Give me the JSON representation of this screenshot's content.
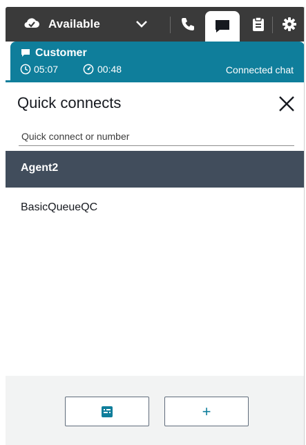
{
  "topbar": {
    "status_label": "Available",
    "icons": [
      "cloud-status-icon",
      "chevron-down-icon",
      "phone-icon",
      "chat-icon",
      "clipboard-icon",
      "gear-icon"
    ]
  },
  "contact": {
    "name": "Customer",
    "duration": "05:07",
    "state_time": "00:48",
    "state": "Connected chat"
  },
  "panel": {
    "title": "Quick connects",
    "search_placeholder": "Quick connect or number",
    "items": [
      {
        "label": "Agent2",
        "selected": true
      },
      {
        "label": "BasicQueueQC",
        "selected": false
      }
    ],
    "footer_buttons": [
      {
        "icon": "directory-icon"
      },
      {
        "icon": "plus-icon",
        "label": "+"
      }
    ]
  },
  "colors": {
    "topbar": "#3a3a3a",
    "accent": "#0f7e9b",
    "selected_row": "#414d5c",
    "footer": "#f2f3f3"
  }
}
